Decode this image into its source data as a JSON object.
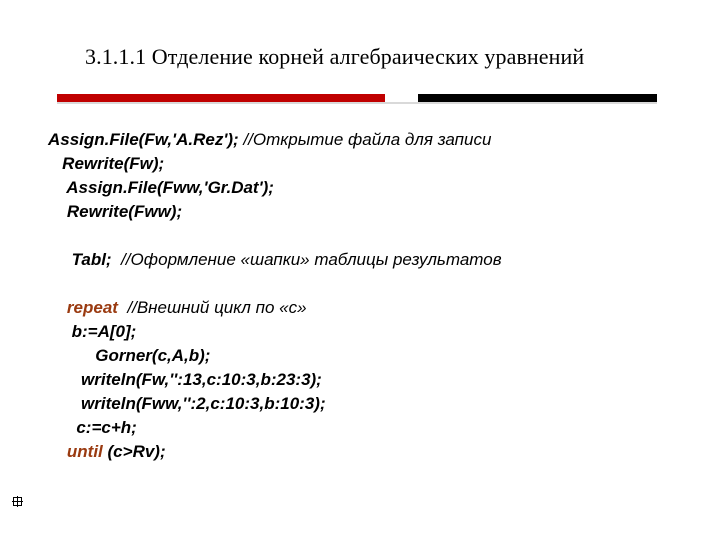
{
  "title": "3.1.1.1  Отделение корней алгебраических уравнений",
  "code": {
    "l1a": "Assign.File(Fw,'A.Rez'); ",
    "l1b": "//Открытие файла для записи",
    "l2": "   Rewrite(Fw);",
    "l3": "    Assign.File(Fww,'Gr.Dat');",
    "l4": "    Rewrite(Fww);",
    "l5a": "     Tabl;  ",
    "l5b": "//Оформление «шапки» таблицы результатов",
    "l6a": "    ",
    "l6kw": "repeat",
    "l6b": "  //Внешний цикл по «c»",
    "l7": "     b:=A[0];",
    "l8": "          Gorner(c,A,b);",
    "l9": "       writeln(Fw,'':13,c:10:3,b:23:3);",
    "l10": "       writeln(Fww,'':2,c:10:3,b:10:3);",
    "l11": "      c:=c+h;",
    "l12a": "    ",
    "l12kw": "until",
    "l12b": " (c>Rv);"
  }
}
